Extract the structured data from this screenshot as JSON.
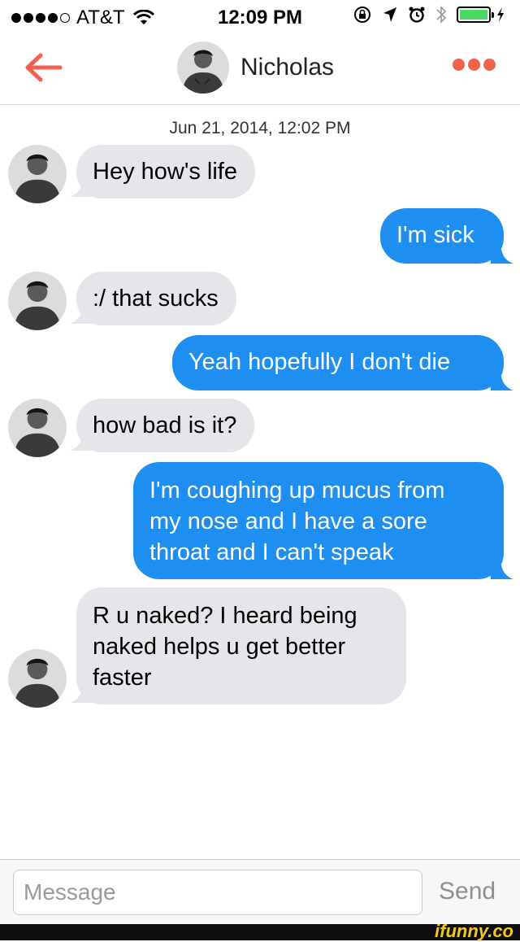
{
  "status_bar": {
    "carrier": "AT&T",
    "time": "12:09 PM",
    "signal_bars": 4,
    "battery_level": 1.0,
    "icons": [
      "signal-dots",
      "wifi-icon",
      "lock-rotation-icon",
      "location-arrow-icon",
      "alarm-icon",
      "bluetooth-icon",
      "battery-icon",
      "charging-bolt-icon"
    ]
  },
  "nav": {
    "back_icon": "back-arrow-icon",
    "contact_name": "Nicholas",
    "more_icon": "more-dots-icon",
    "accent_color": "#f0624d"
  },
  "conversation": {
    "timestamp": "Jun 21, 2014, 12:02 PM",
    "messages": [
      {
        "sender": "Nicholas",
        "direction": "in",
        "text": "Hey how's life"
      },
      {
        "sender": "me",
        "direction": "out",
        "text": "I'm sick"
      },
      {
        "sender": "Nicholas",
        "direction": "in",
        "text": ":/ that sucks"
      },
      {
        "sender": "me",
        "direction": "out",
        "text": "Yeah hopefully I don't die"
      },
      {
        "sender": "Nicholas",
        "direction": "in",
        "text": "how bad is it?"
      },
      {
        "sender": "me",
        "direction": "out",
        "lines": [
          "I'm coughing up mucus from",
          "my nose and I have a sore",
          "throat and I can't speak"
        ]
      },
      {
        "sender": "Nicholas",
        "direction": "in",
        "lines": [
          "R u naked? I heard being",
          "naked helps u get better",
          "faster"
        ]
      }
    ],
    "colors": {
      "outgoing": "#1f8ef1",
      "incoming": "#e5e5ea"
    }
  },
  "composer": {
    "placeholder": "Message",
    "value": "",
    "send_label": "Send"
  },
  "watermark": "ifunny.co"
}
